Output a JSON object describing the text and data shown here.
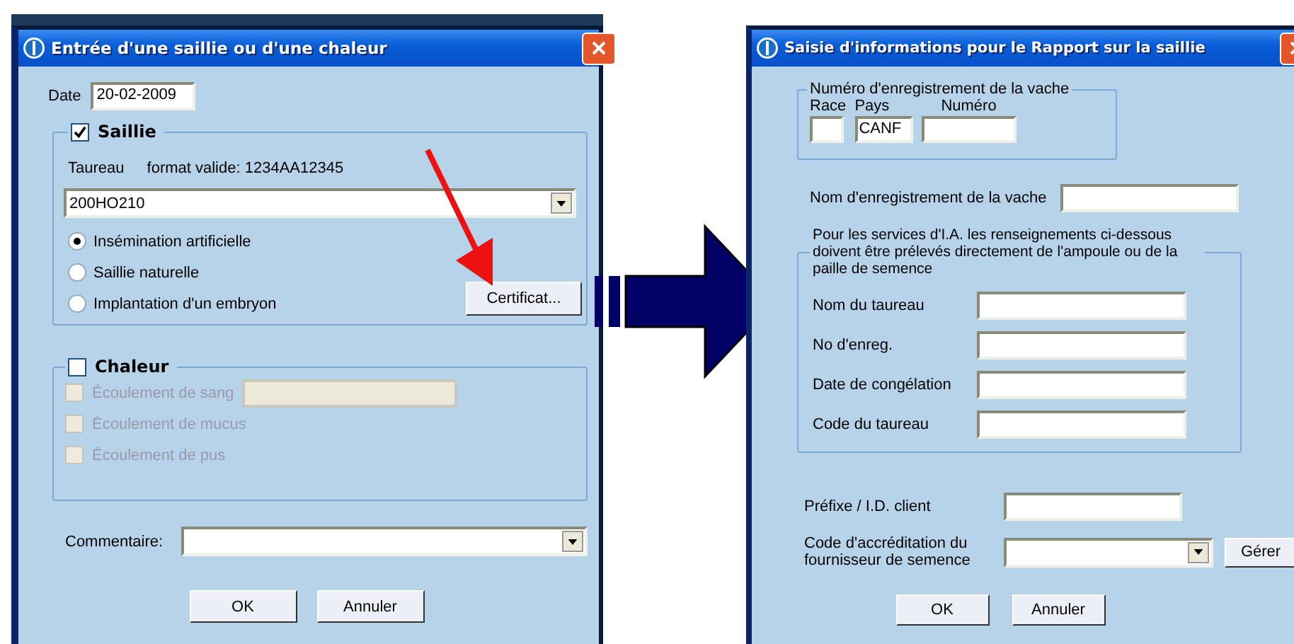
{
  "saillie_dialog": {
    "title": "Entrée d'une saillie ou d'une chaleur",
    "date": {
      "label": "Date",
      "value": "20-02-2009"
    },
    "saillie": {
      "label": "Saillie",
      "checked": true,
      "taureau_label": "Taureau",
      "format_hint": "format valide: 1234AA12345",
      "taureau_value": "200HO210",
      "options": [
        {
          "label": "Insémination artificielle",
          "selected": true
        },
        {
          "label": "Saillie naturelle",
          "selected": false
        },
        {
          "label": "Implantation d'un embryon",
          "selected": false
        }
      ],
      "certificate_button": "Certificat..."
    },
    "chaleur": {
      "label": "Chaleur",
      "checked": false,
      "options": [
        {
          "label": "Écoulement de sang",
          "kind": "with_field",
          "checked": false,
          "disabled": true
        },
        {
          "label": "Écoulement de mucus",
          "kind": "plain",
          "checked": false,
          "disabled": true
        },
        {
          "label": "Écoulement de pus",
          "kind": "plain",
          "checked": false,
          "disabled": true
        }
      ]
    },
    "comment_label": "Commentaire:",
    "buttons": [
      "OK",
      "Annuler"
    ]
  },
  "rapport_dialog": {
    "title": "Saisie d'informations pour le Rapport sur la saillie",
    "registration_group": {
      "title": "Numéro d'enregistrement de la vache",
      "fields": [
        {
          "label": "Race",
          "kind": "short"
        },
        {
          "label": "Pays",
          "kind": "medium",
          "value": "CANF"
        },
        {
          "label": "Numéro",
          "kind": "long"
        }
      ]
    },
    "cow_name_label": "Nom d'enregistrement de la vache",
    "ai_group": {
      "title": "Pour les services d'I.A. les renseignements ci-dessous doivent être prélevés directement de l'ampoule ou de la paille de semence",
      "fields": [
        {
          "label": "Nom du taureau"
        },
        {
          "label": "No d'enreg."
        },
        {
          "label": "Date de congélation"
        },
        {
          "label": "Code du taureau"
        }
      ]
    },
    "prefix_label": "Préfixe / I.D. client",
    "accreditation_label": "Code d'accréditation du fournisseur de semence",
    "manage_button": "Gérer",
    "buttons": [
      "OK",
      "Annuler"
    ]
  }
}
